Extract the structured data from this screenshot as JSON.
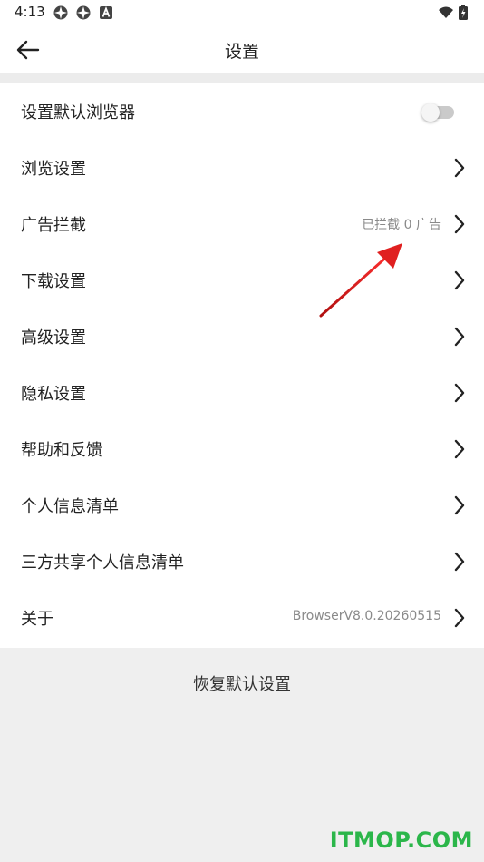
{
  "status_bar": {
    "time": "4:13",
    "icons": [
      "notification-icon-1",
      "notification-icon-2",
      "text-a-icon",
      "wifi-icon",
      "battery-icon"
    ]
  },
  "app_bar": {
    "title": "设置",
    "back_icon": "back-arrow-icon"
  },
  "settings": {
    "items": [
      {
        "label": "设置默认浏览器",
        "control": "toggle",
        "toggle_on": false
      },
      {
        "label": "浏览设置",
        "control": "chevron"
      },
      {
        "label": "广告拦截",
        "value": "已拦截 0 广告",
        "control": "chevron"
      },
      {
        "label": "下载设置",
        "control": "chevron"
      },
      {
        "label": "高级设置",
        "control": "chevron"
      },
      {
        "label": "隐私设置",
        "control": "chevron"
      },
      {
        "label": "帮助和反馈",
        "control": "chevron"
      },
      {
        "label": "个人信息清单",
        "control": "chevron"
      },
      {
        "label": "三方共享个人信息清单",
        "control": "chevron"
      },
      {
        "label": "关于",
        "value": "BrowserV8.0.20260515",
        "control": "chevron"
      }
    ]
  },
  "restore_defaults": "恢复默认设置",
  "annotation": {
    "icon": "red-arrow-icon",
    "color": "#e02020"
  },
  "watermark": "ITMOP.COM"
}
